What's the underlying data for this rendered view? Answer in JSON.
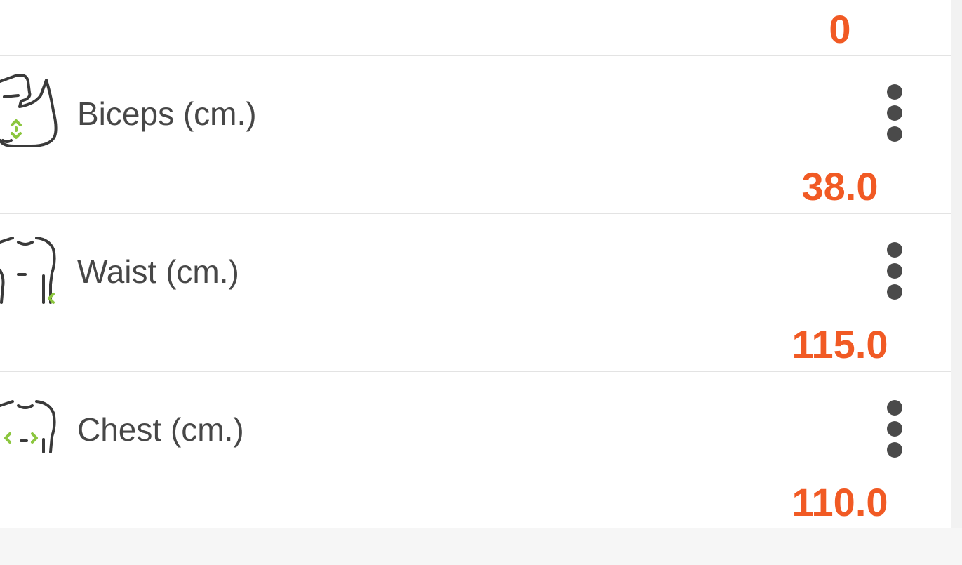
{
  "top_value": "0",
  "measurements": [
    {
      "label": "Biceps (cm.)",
      "value": "38.0",
      "icon": "biceps-icon"
    },
    {
      "label": "Waist (cm.)",
      "value": "115.0",
      "icon": "waist-icon"
    },
    {
      "label": "Chest (cm.)",
      "value": "110.0",
      "icon": "chest-icon"
    }
  ],
  "colors": {
    "value": "#f15a24",
    "icon_accent": "#8cc63f",
    "icon_line": "#3a3a3a",
    "label": "#474747"
  }
}
